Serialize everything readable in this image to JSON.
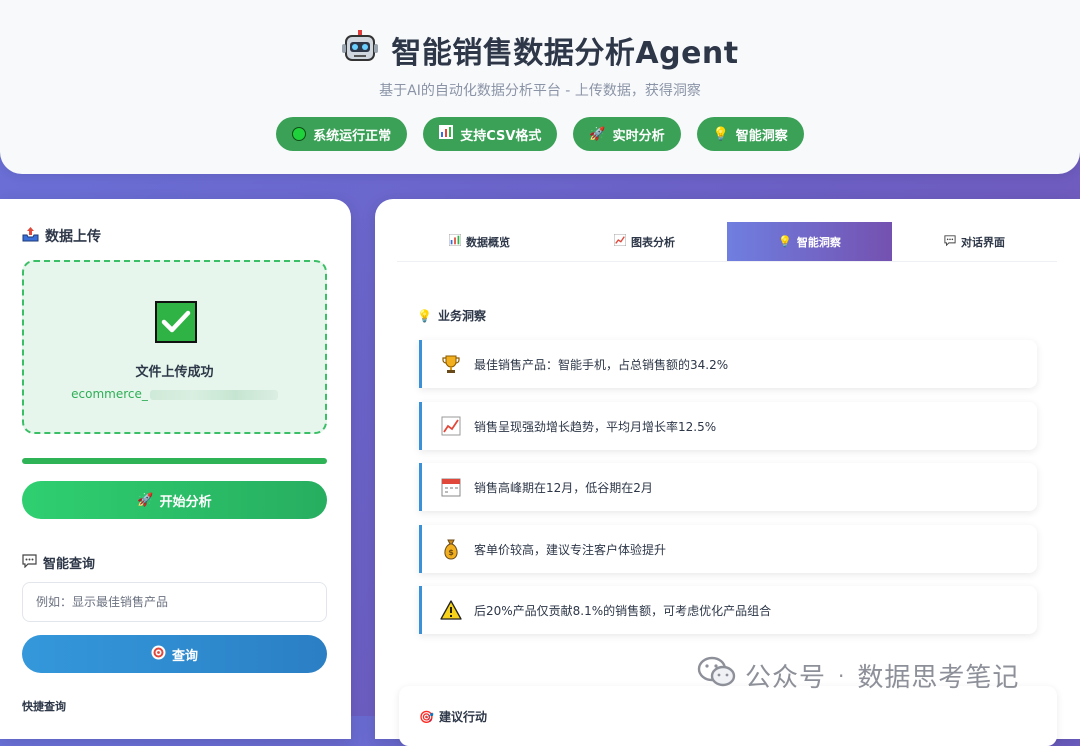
{
  "header": {
    "title": "智能销售数据分析Agent",
    "subtitle": "基于AI的自动化数据分析平台 - 上传数据，获得洞察",
    "badges": [
      {
        "label": "系统运行正常",
        "icon": "green-dot-icon"
      },
      {
        "label": "支持CSV格式",
        "icon": "bar-chart-icon"
      },
      {
        "label": "实时分析",
        "icon": "rocket-icon"
      },
      {
        "label": "智能洞察",
        "icon": "lightbulb-icon"
      }
    ]
  },
  "left": {
    "upload_title": "数据上传",
    "upload_success": "文件上传成功",
    "upload_filename": "ecommerce_",
    "upload_progress": 1.0,
    "analyze_button": "开始分析",
    "query_title": "智能查询",
    "query_placeholder": "例如：显示最佳销售产品",
    "query_button": "查询",
    "quick_query_label": "快捷查询"
  },
  "right": {
    "tabs": [
      {
        "label": "数据概览",
        "icon": "bar-chart-icon",
        "active": false
      },
      {
        "label": "图表分析",
        "icon": "line-chart-icon",
        "active": false
      },
      {
        "label": "智能洞察",
        "icon": "lightbulb-icon",
        "active": true
      },
      {
        "label": "对话界面",
        "icon": "speech-bubble-icon",
        "active": false
      }
    ],
    "insights_title": "业务洞察",
    "insights": [
      {
        "icon": "trophy-icon",
        "text": "最佳销售产品：智能手机，占总销售额的34.2%"
      },
      {
        "icon": "trend-up-icon",
        "text": "销售呈现强劲增长趋势，平均月增长率12.5%"
      },
      {
        "icon": "calendar-icon",
        "text": "销售高峰期在12月，低谷期在2月"
      },
      {
        "icon": "money-bag-icon",
        "text": "客单价较高，建议专注客户体验提升"
      },
      {
        "icon": "warning-icon",
        "text": "后20%产品仅贡献8.1%的销售额，可考虑优化产品组合"
      }
    ],
    "actions_title": "建议行动"
  },
  "watermark": {
    "left": "公众号",
    "sep": "·",
    "right": "数据思考笔记"
  },
  "colors": {
    "accent_green": "#3aa157",
    "accent_blue": "#3b91d8",
    "active_tab_start": "#6f7fe0",
    "active_tab_end": "#7451b0"
  }
}
